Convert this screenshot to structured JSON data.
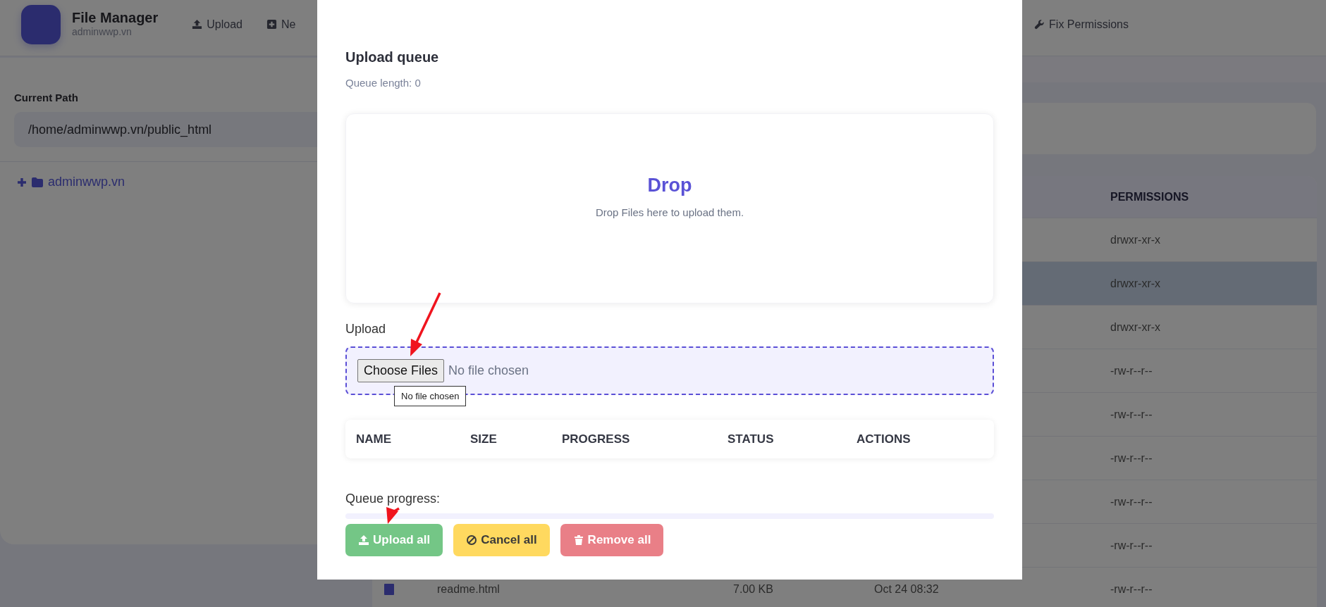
{
  "header": {
    "title": "File Manager",
    "subtitle": "adminwwp.vn",
    "toolbar": [
      {
        "label": "Upload",
        "kind": "upload"
      },
      {
        "label": "Ne",
        "kind": "new"
      },
      {
        "label": "Fix Permissions",
        "kind": "wrench"
      }
    ]
  },
  "sidebar": {
    "path_label": "Current Path",
    "path": "/home/adminwwp.vn/public_html",
    "tree": [
      {
        "label": "adminwwp.vn",
        "expanded": false
      }
    ]
  },
  "file_table": {
    "columns": [
      "PERMISSIONS"
    ],
    "rows": [
      {
        "permissions": "drwxr-xr-x",
        "selected": false
      },
      {
        "permissions": "drwxr-xr-x",
        "selected": true
      },
      {
        "permissions": "drwxr-xr-x",
        "selected": false
      },
      {
        "permissions": "-rw-r--r--",
        "selected": false
      },
      {
        "permissions": "-rw-r--r--",
        "selected": false
      },
      {
        "permissions": "-rw-r--r--",
        "selected": false
      },
      {
        "permissions": "-rw-r--r--",
        "selected": false
      },
      {
        "permissions": "-rw-r--r--",
        "selected": false
      },
      {
        "name": "readme.html",
        "size": "7.00 KB",
        "modified": "Oct 24 08:32",
        "permissions": "-rw-r--r--",
        "selected": false
      }
    ]
  },
  "modal": {
    "title": "Upload queue",
    "queue_length": "Queue length: 0",
    "drop_zone": {
      "title": "Drop",
      "hint": "Drop Files here to upload them."
    },
    "upload_label": "Upload",
    "file_input": {
      "button": "Choose Files",
      "value": "No file chosen",
      "tooltip": "No file chosen"
    },
    "queue_table": {
      "columns": [
        "NAME",
        "SIZE",
        "PROGRESS",
        "STATUS",
        "ACTIONS"
      ]
    },
    "queue_progress": {
      "label": "Queue progress:",
      "level": 0
    },
    "buttons": [
      {
        "label": "Upload all",
        "kind": "upload"
      },
      {
        "label": "Cancel all",
        "kind": "cancel"
      },
      {
        "label": "Remove all",
        "kind": "remove"
      }
    ]
  }
}
